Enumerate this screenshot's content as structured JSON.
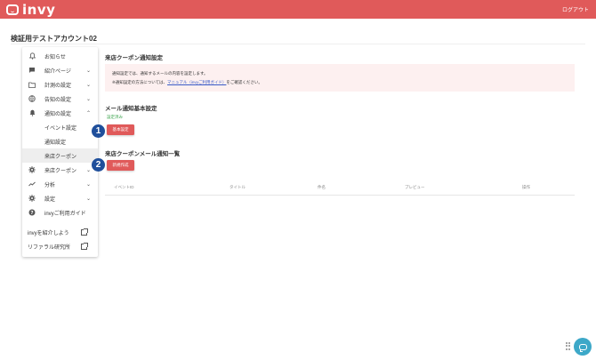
{
  "header": {
    "logo_text": "invy",
    "logout_label": "ログアウト",
    "brand_color": "#e05a5a"
  },
  "account": {
    "title": "検証用テストアカウント02"
  },
  "sidebar": {
    "items": [
      {
        "label": "お知らせ",
        "icon": "bell-icon"
      },
      {
        "label": "紹介ページ",
        "icon": "chat-icon",
        "chevron": "⌄"
      },
      {
        "label": "計測の設定",
        "icon": "folder-icon",
        "chevron": "⌄"
      },
      {
        "label": "告知の設定",
        "icon": "globe-icon",
        "chevron": "⌄"
      },
      {
        "label": "通知の設定",
        "icon": "bell-filled-icon",
        "chevron": "⌃"
      },
      {
        "label": "イベント設定"
      },
      {
        "label": "通知設定"
      },
      {
        "label": "来店クーポン"
      },
      {
        "label": "来店クーポン",
        "icon": "gear-icon",
        "chevron": "⌄"
      },
      {
        "label": "分析",
        "icon": "trend-icon",
        "chevron": "⌄"
      },
      {
        "label": "設定",
        "icon": "gear-icon",
        "chevron": "⌄"
      },
      {
        "label": "invyご利用ガイド",
        "icon": "help-icon"
      },
      {
        "label": "invyを紹介しよう",
        "icon": "external-link-icon"
      },
      {
        "label": "リファラル研究所",
        "icon": "external-link-icon"
      }
    ]
  },
  "main": {
    "section_title": "来店クーポン通知設定",
    "notice_line1": "通知設定では、通知するメールの内容を設定します。",
    "notice_line2_prefix": "※通知設定の方法については、",
    "notice_link": "マニュアル（invyご利用ガイド）",
    "notice_line2_suffix": "をご確認ください。",
    "mail_settings_title": "メール通知基本設定",
    "status_done": "設定済み",
    "basic_settings_button": "基本設定",
    "list_title": "来店クーポンメール通知一覧",
    "new_button": "新規作成",
    "table_headers": [
      "イベントID",
      "タイトル",
      "件名",
      "プレビュー",
      "操作"
    ]
  },
  "steps": [
    "1",
    "2"
  ],
  "colors": {
    "button": "#e05a5a",
    "step_badge": "#1f4f9b",
    "chat_button": "#3da8c8",
    "status_green": "#3aa34b"
  }
}
